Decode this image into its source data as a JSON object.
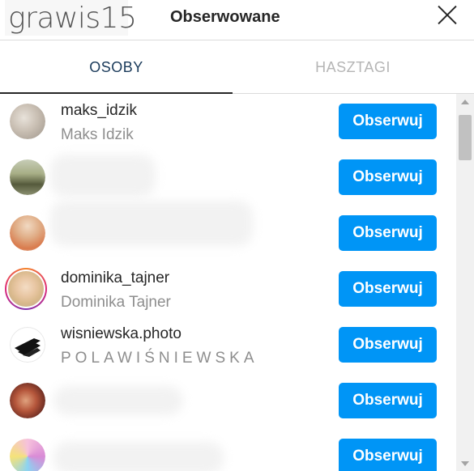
{
  "header": {
    "username": "grawis15",
    "title": "Obserwowane",
    "close_icon": "close-icon"
  },
  "tabs": [
    {
      "label": "OSOBY",
      "active": true
    },
    {
      "label": "HASZTAGI",
      "active": false
    }
  ],
  "follow_label": "Obserwuj",
  "accounts": [
    {
      "username": "maks_idzik",
      "full_name": "Maks Idzik"
    },
    {
      "username": "",
      "full_name": ""
    },
    {
      "username": "",
      "full_name": ""
    },
    {
      "username": "dominika_tajner",
      "full_name": "Dominika Tajner"
    },
    {
      "username": "wisniewska.photo",
      "full_name": "POLAWIŚNIEWSKA"
    },
    {
      "username": "",
      "full_name": ""
    },
    {
      "username": "",
      "full_name": ""
    }
  ],
  "colors": {
    "primary": "#0095f6",
    "text": "#262626",
    "secondary_text": "#8e8e8e",
    "border": "#dbdbdb"
  }
}
